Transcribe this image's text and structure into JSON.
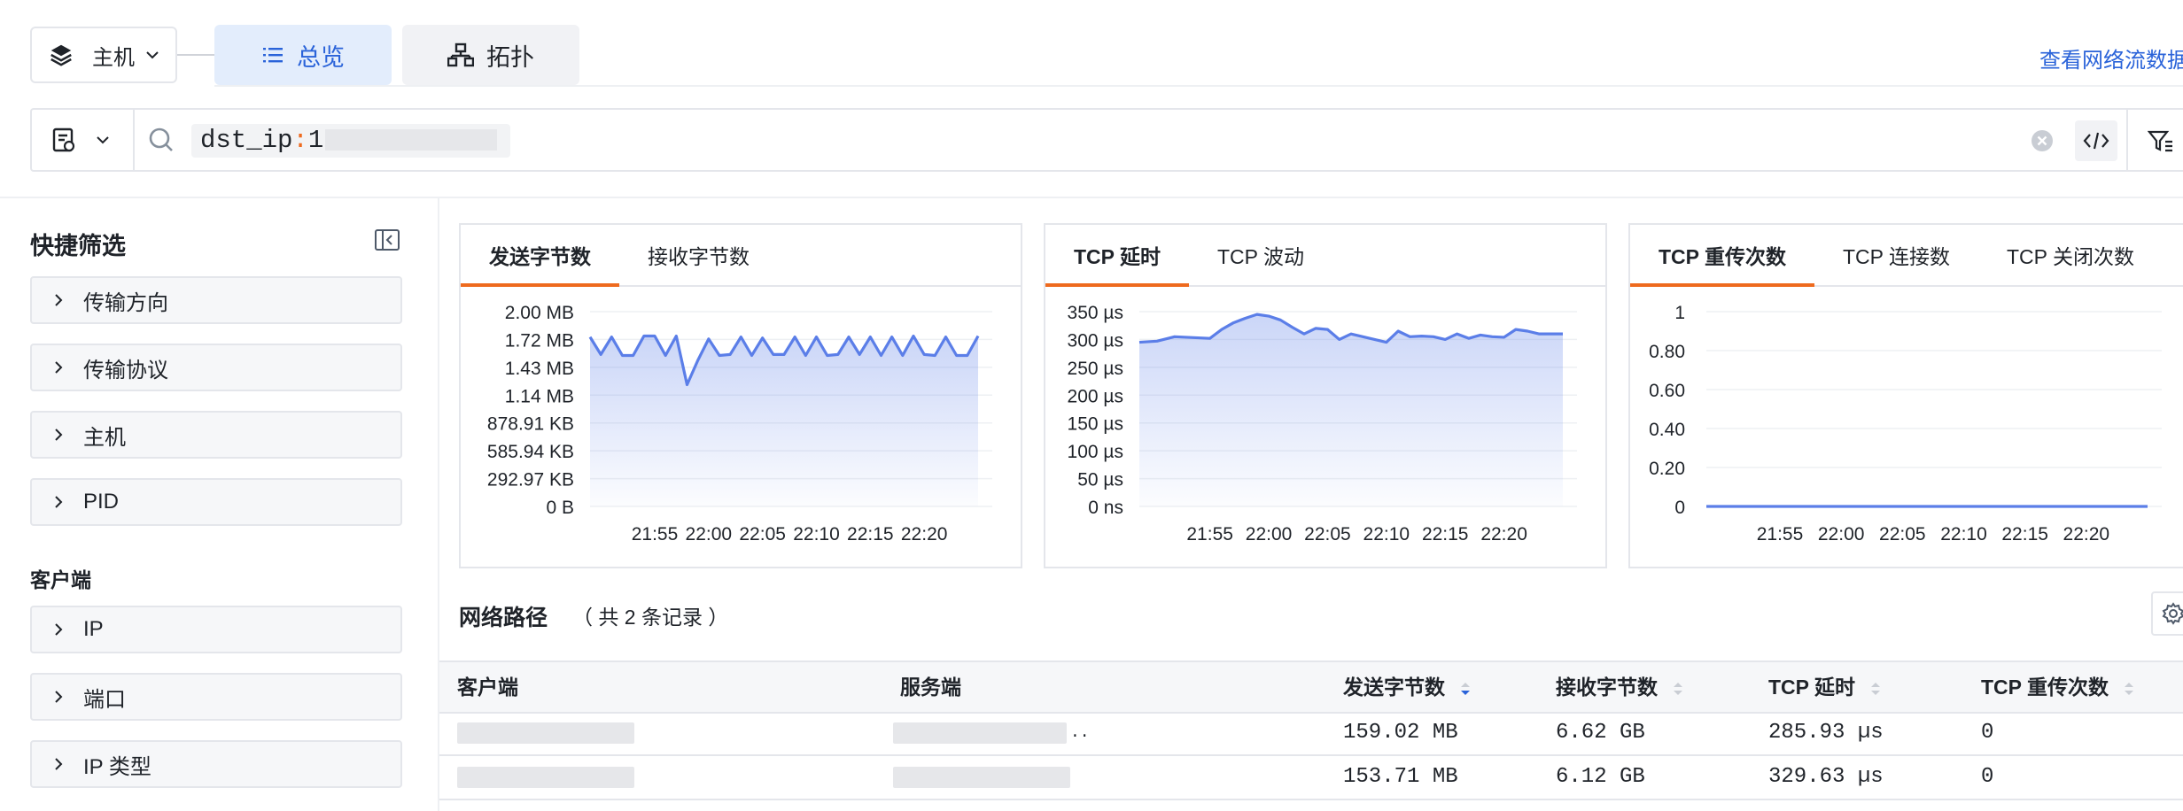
{
  "header": {
    "host_label": "主机",
    "tabs": [
      {
        "label": "总览",
        "active": true
      },
      {
        "label": "拓扑",
        "active": false
      }
    ],
    "link_text": "查看网络流数据"
  },
  "search": {
    "query_key": "dst_ip",
    "query_colon": ":",
    "query_value_visible": "1"
  },
  "sidebar": {
    "title": "快捷筛选",
    "items": [
      "传输方向",
      "传输协议",
      "主机",
      "PID"
    ],
    "client_group_title": "客户端",
    "client_items": [
      "IP",
      "端口",
      "IP 类型"
    ]
  },
  "chart_cards": [
    {
      "tabs": [
        {
          "label": "发送字节数",
          "active": true
        },
        {
          "label": "接收字节数",
          "active": false
        }
      ]
    },
    {
      "tabs": [
        {
          "label": "TCP 延时",
          "active": true
        },
        {
          "label": "TCP 波动",
          "active": false
        }
      ]
    },
    {
      "tabs": [
        {
          "label": "TCP 重传次数",
          "active": true
        },
        {
          "label": "TCP 连接数",
          "active": false
        },
        {
          "label": "TCP 关闭次数",
          "active": false
        }
      ]
    }
  ],
  "chart_data": [
    {
      "type": "area",
      "title": "发送字节数",
      "y_tick_labels": [
        "2.00 MB",
        "1.72 MB",
        "1.43 MB",
        "1.14 MB",
        "878.91 KB",
        "585.94 KB",
        "292.97 KB",
        "0 B"
      ],
      "x_tick_labels": [
        "21:55",
        "22:00",
        "22:05",
        "22:10",
        "22:15",
        "22:20"
      ],
      "ylim_mb": [
        0,
        2.0
      ],
      "x_minutes": [
        -6,
        -5,
        -4,
        -3,
        -2,
        -1,
        0,
        1,
        2,
        3,
        4,
        5,
        6,
        7,
        8,
        9,
        10,
        11,
        12,
        13,
        14,
        15,
        16,
        17,
        18,
        19,
        20,
        21,
        22,
        23,
        24,
        25,
        26,
        27,
        28,
        29,
        30
      ],
      "values_mb": [
        1.74,
        1.56,
        1.74,
        1.55,
        1.55,
        1.75,
        1.75,
        1.55,
        1.75,
        1.25,
        1.5,
        1.72,
        1.55,
        1.56,
        1.74,
        1.55,
        1.73,
        1.56,
        1.56,
        1.74,
        1.55,
        1.74,
        1.55,
        1.56,
        1.74,
        1.56,
        1.74,
        1.55,
        1.74,
        1.55,
        1.75,
        1.56,
        1.55,
        1.74,
        1.55,
        1.55,
        1.75
      ],
      "grid": true,
      "color": "#5b7ee8"
    },
    {
      "type": "area",
      "title": "TCP 延时",
      "y_tick_labels": [
        "350 µs",
        "300 µs",
        "250 µs",
        "200 µs",
        "150 µs",
        "100 µs",
        "50 µs",
        "0 ns"
      ],
      "x_tick_labels": [
        "21:55",
        "22:00",
        "22:05",
        "22:10",
        "22:15",
        "22:20"
      ],
      "ylim_us": [
        0,
        350
      ],
      "x_minutes": [
        -6,
        -4.5,
        -3,
        -1,
        0,
        1,
        2,
        3,
        4,
        5,
        6,
        7,
        8,
        9,
        10,
        11,
        12,
        13,
        14,
        15,
        16,
        17,
        18,
        19,
        20,
        21,
        22,
        23,
        24,
        25,
        26,
        27,
        28,
        29,
        30
      ],
      "values_us": [
        295,
        297,
        305,
        303,
        302,
        318,
        330,
        338,
        345,
        342,
        335,
        322,
        310,
        320,
        318,
        300,
        310,
        305,
        300,
        295,
        315,
        305,
        306,
        305,
        300,
        310,
        302,
        308,
        305,
        304,
        318,
        315,
        310,
        310,
        310
      ],
      "grid": true,
      "color": "#5b7ee8"
    },
    {
      "type": "line",
      "title": "TCP 重传次数",
      "y_tick_labels": [
        "1",
        "0.80",
        "0.60",
        "0.40",
        "0.20",
        "0"
      ],
      "x_tick_labels": [
        "21:55",
        "22:00",
        "22:05",
        "22:10",
        "22:15",
        "22:20"
      ],
      "ylim": [
        0,
        1
      ],
      "x_minutes": [
        -6,
        30
      ],
      "values": [
        0,
        0
      ],
      "grid": true,
      "color": "#5b7ee8"
    }
  ],
  "table": {
    "title": "网络路径",
    "count_text": "（ 共 2 条记录 ）",
    "columns": [
      "客户端",
      "服务端",
      "发送字节数",
      "接收字节数",
      "TCP 延时",
      "TCP 重传次数"
    ],
    "rows": [
      {
        "client": "",
        "server": "..",
        "sent": "159.02 MB",
        "recv": "6.62 GB",
        "latency": "285.93 µs",
        "retrans": "0"
      },
      {
        "client": "",
        "server": "",
        "sent": "153.71 MB",
        "recv": "6.12 GB",
        "latency": "329.63 µs",
        "retrans": "0"
      }
    ]
  }
}
